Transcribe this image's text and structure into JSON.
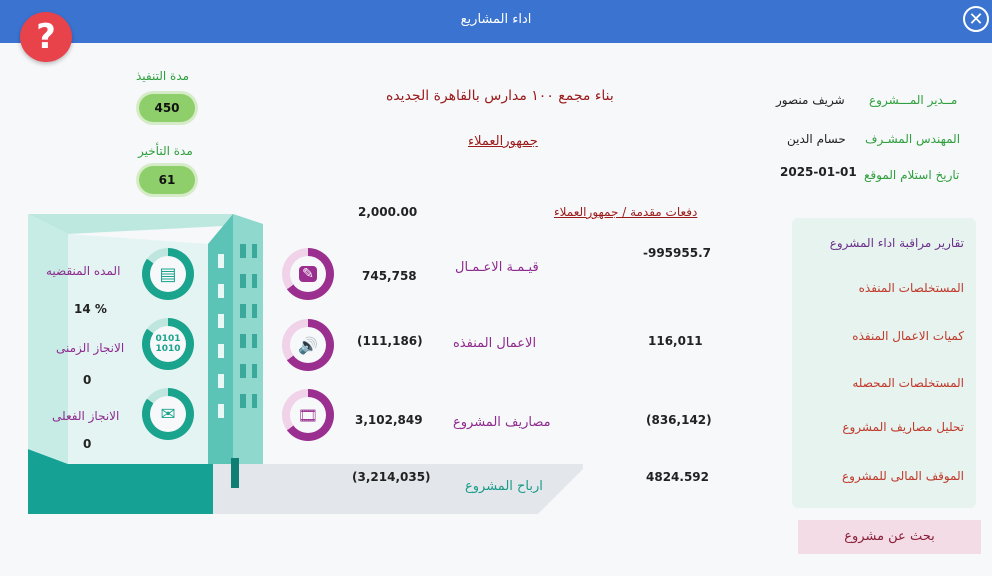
{
  "window": {
    "title": "اداء المشاريع",
    "close_glyph": "✕",
    "help_glyph": "?"
  },
  "durations": {
    "execution_label": "مدة التنفيذ",
    "execution_value": "450",
    "delay_label": "مدة التأخير",
    "delay_value": "61"
  },
  "project": {
    "title": "بناء مجمع ١٠٠ مدارس بالقاهرة الجديده",
    "client": "جمهورالعملاء",
    "manager_label": "مــدير المـــشروع",
    "manager_value": "شريف منصور",
    "engineer_label": "المهندس المشـرف",
    "engineer_value": "حسام الدين",
    "site_date_label": "تاريخ استلام الموقع",
    "site_date_value": "2025-01-01"
  },
  "advance": {
    "label": "دفعات مقدمة / جمهورالعملاء",
    "value": "2,000.00"
  },
  "metrics": {
    "works_value_label": "قيـمـة الاعـمـال",
    "works_value": "745,758",
    "works_value_right": "-995955.7",
    "executed_label": "الاعمال المنفذه",
    "executed_value": "(111,186)",
    "executed_right": "116,011",
    "expenses_label": "مصاريف المشروع",
    "expenses_value": "3,102,849",
    "expenses_right": "(836,142)",
    "profit_label": "ارباح المشروع",
    "profit_value": "(3,214,035)",
    "profit_right": "4824.592"
  },
  "progress": {
    "elapsed_label": "المده المنقضيه",
    "elapsed_value": "14 %",
    "time_label": "الانجاز الزمنى",
    "time_value": "0",
    "actual_label": "الانجاز الفعلى",
    "actual_value": "0"
  },
  "reports": {
    "items": [
      "تقارير مراقبة اداء المشروع",
      "المستخلصات المنفذه",
      "كميات الاعمال المنفذه",
      "المستخلصات المحصله",
      "تحليل مصاريف المشروع",
      "الموقف المالى للمشروع"
    ],
    "search_button": "بحث عن مشروع"
  },
  "colors": {
    "titlebar": "#3b73d1",
    "teal": "#1aa38d",
    "purple": "#9a2f8f",
    "pill": "#8fcf6b"
  }
}
